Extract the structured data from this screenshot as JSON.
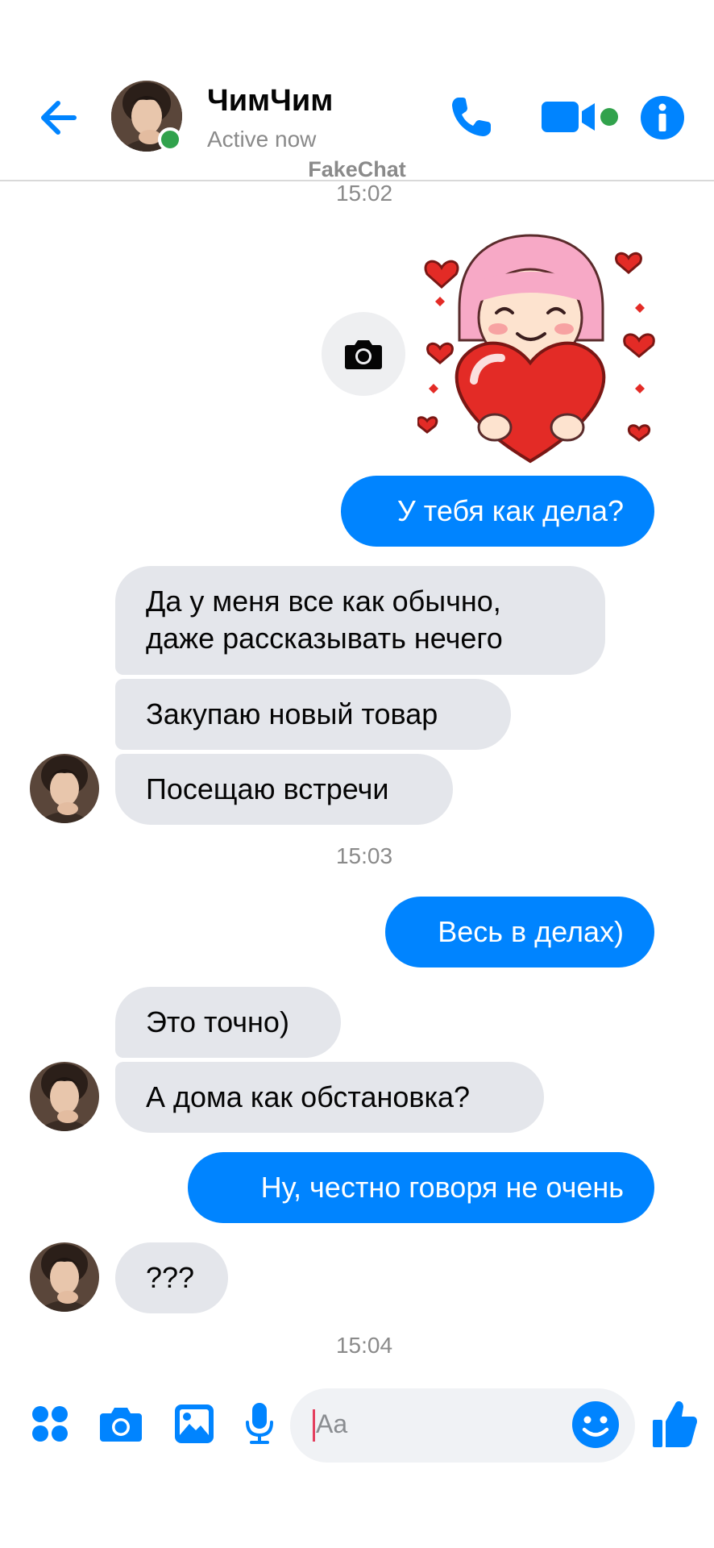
{
  "header": {
    "contact_name": "ЧимЧим",
    "status": "Active now",
    "watermark": "FakeChat"
  },
  "messages": {
    "time_1": "15:02",
    "out_1": "У тебя как дела?",
    "in_1_line1": "Да у меня все как обычно,",
    "in_1_line2": "даже рассказывать нечего",
    "in_2": "Закупаю новый товар",
    "in_3": "Посещаю встречи",
    "time_2": "15:03",
    "out_2": "Весь в делах)",
    "in_4": "Это точно)",
    "in_5": "А дома как обстановка?",
    "out_3": "Ну, честно говоря не очень",
    "in_6": "???",
    "time_3": "15:04"
  },
  "composer": {
    "placeholder": "Aa"
  },
  "colors": {
    "accent": "#0084ff",
    "incoming_bubble": "#e4e6eb",
    "online": "#31a24c"
  },
  "icons": [
    "back-arrow-icon",
    "phone-icon",
    "video-camera-icon",
    "info-icon",
    "camera-icon",
    "apps-icon",
    "gallery-icon",
    "microphone-icon",
    "emoji-icon",
    "thumbs-up-icon",
    "heart-sticker"
  ]
}
